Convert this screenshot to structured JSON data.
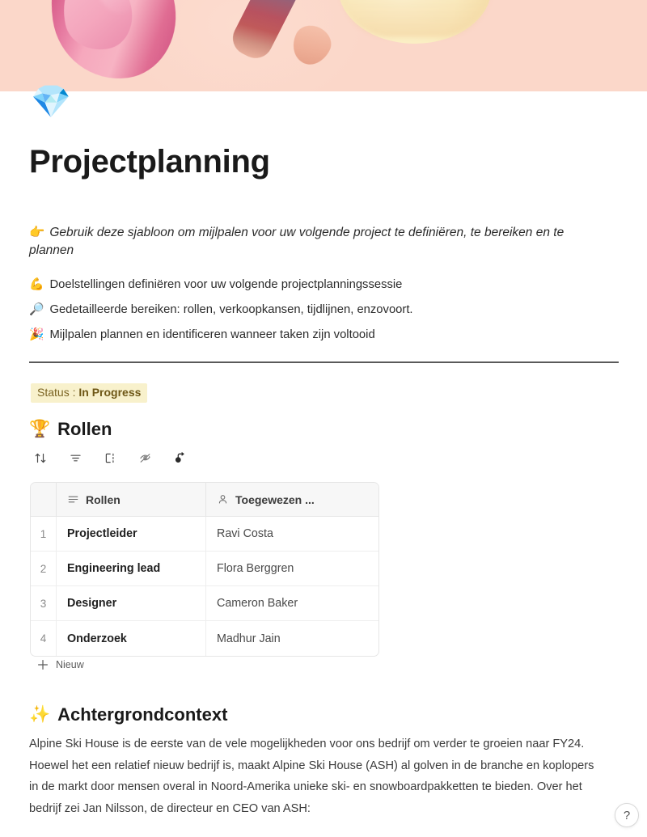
{
  "page": {
    "emoji": "💎",
    "title": "Projectplanning"
  },
  "banner": {
    "background_color": "#fbd7c9",
    "accent_pink": "#c9447a",
    "accent_cream": "#fbeec3"
  },
  "intro": {
    "emoji": "👉",
    "text": "Gebruik deze sjabloon om mijlpalen voor uw volgende project te definiëren, te bereiken en te plannen"
  },
  "bullets": [
    {
      "emoji": "💪",
      "text": "Doelstellingen definiëren voor uw volgende projectplanningssessie"
    },
    {
      "emoji": "🔎",
      "text": "Gedetailleerde bereiken: rollen, verkoopkansen, tijdlijnen, enzovoort."
    },
    {
      "emoji": "🎉",
      "text": "Mijlpalen plannen en identificeren wanneer taken zijn voltooid"
    }
  ],
  "status": {
    "label": "Status : ",
    "value": "In Progress",
    "background_color": "#f8f1cc",
    "text_color": "#7a6322"
  },
  "rollen_section": {
    "emoji": "🏆",
    "heading": "Rollen",
    "toolbar": [
      {
        "name": "sort-icon",
        "title": "Sorteren"
      },
      {
        "name": "filter-icon",
        "title": "Filteren"
      },
      {
        "name": "group-icon",
        "title": "Groeperen"
      },
      {
        "name": "hide-fields-icon",
        "title": "Velden verbergen"
      },
      {
        "name": "share-view-icon",
        "title": "Weergave delen"
      }
    ],
    "table": {
      "columns": [
        {
          "key": "num",
          "label": "",
          "icon": "row-number"
        },
        {
          "key": "rollen",
          "label": "Rollen",
          "icon": "text-lines-icon"
        },
        {
          "key": "toegewezen",
          "label": "Toegewezen ...",
          "icon": "person-icon"
        }
      ],
      "rows": [
        {
          "num": "1",
          "rollen": "Projectleider",
          "toegewezen": "Ravi Costa"
        },
        {
          "num": "2",
          "rollen": "Engineering lead",
          "toegewezen": "Flora Berggren"
        },
        {
          "num": "3",
          "rollen": "Designer",
          "toegewezen": "Cameron Baker"
        },
        {
          "num": "4",
          "rollen": "Onderzoek",
          "toegewezen": "Madhur Jain"
        }
      ],
      "new_row_label": "Nieuw"
    }
  },
  "context_section": {
    "emoji": "✨",
    "heading": "Achtergrondcontext",
    "paragraph": "Alpine Ski House is de eerste van de vele mogelijkheden voor ons bedrijf om verder te groeien naar FY24. Hoewel het een relatief nieuw bedrijf is, maakt Alpine Ski House (ASH) al golven in de branche en koplopers in de markt door mensen overal in Noord-Amerika unieke ski- en snowboardpakketten te bieden. Over het bedrijf zei Jan Nilsson, de directeur en CEO van ASH:"
  },
  "help": {
    "label": "?"
  }
}
